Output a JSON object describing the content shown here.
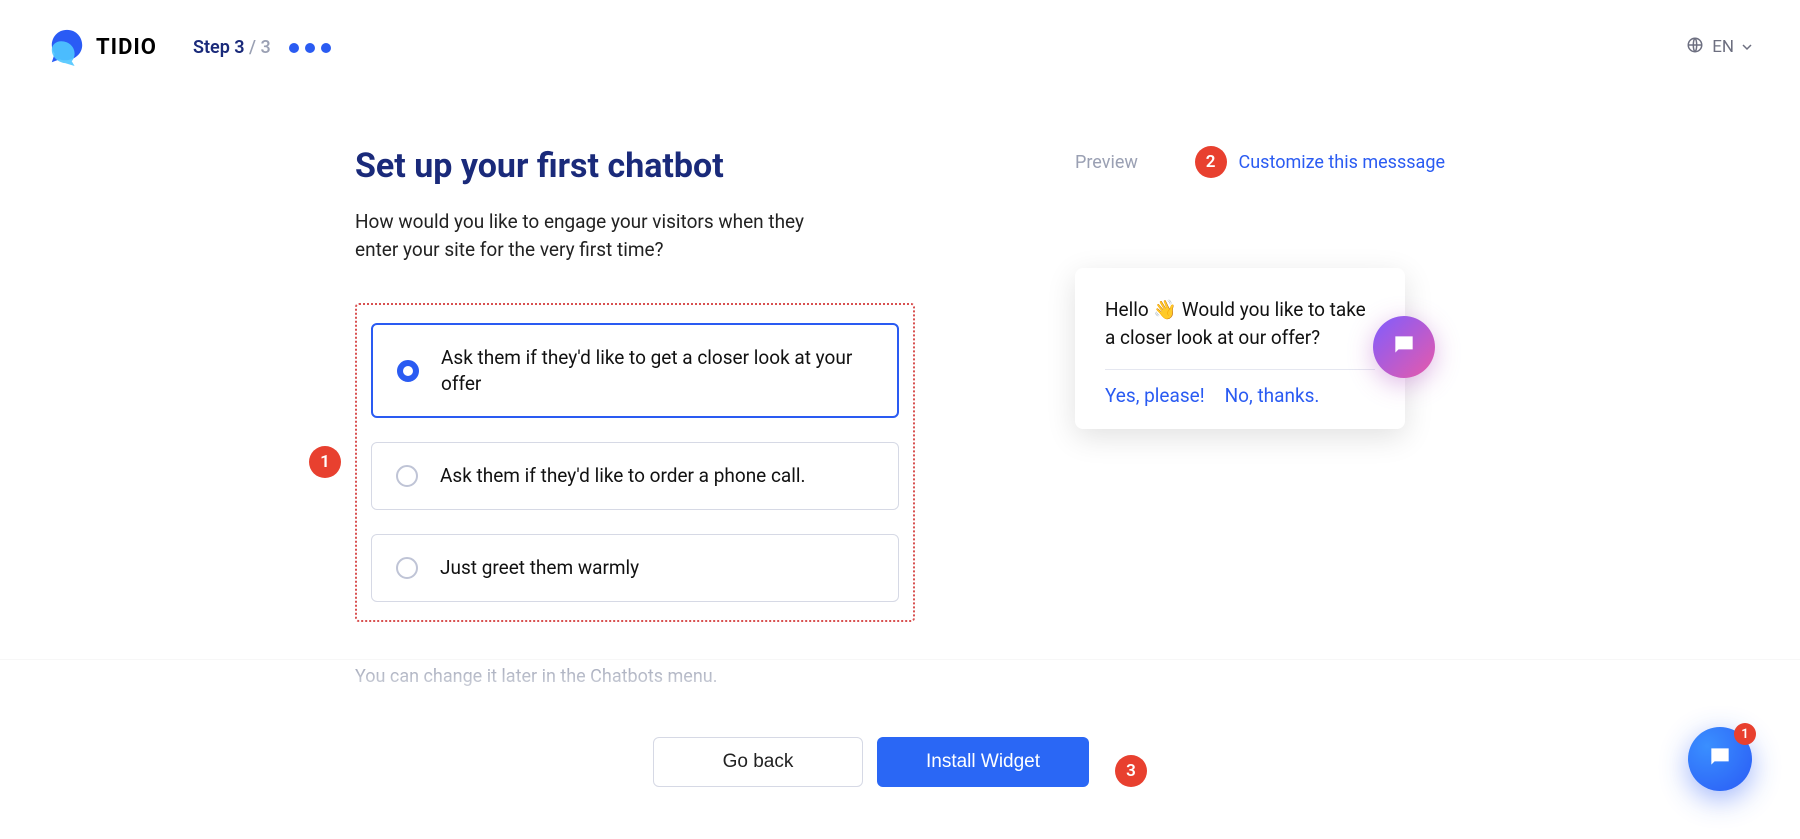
{
  "brand": "TIDIO",
  "step": {
    "label": "Step 3",
    "total": "/ 3"
  },
  "lang": "EN",
  "title": "Set up your first chatbot",
  "subtitle": "How would you like to engage your visitors when they enter your site for the very first time?",
  "options": [
    "Ask them if they'd like to get a closer look at your offer",
    "Ask them if they'd like to order a phone call.",
    "Just greet them warmly"
  ],
  "hint": "You can change it later in the Chatbots menu.",
  "preview": {
    "label": "Preview",
    "customize": "Customize this messsage",
    "message": "Hello 👋 Would you like to take a closer look at our offer?",
    "yes": "Yes, please!",
    "no": "No, thanks."
  },
  "footer": {
    "back": "Go back",
    "install": "Install Widget"
  },
  "annotations": {
    "a1": "1",
    "a2": "2",
    "a3": "3"
  },
  "float_badge": "1"
}
